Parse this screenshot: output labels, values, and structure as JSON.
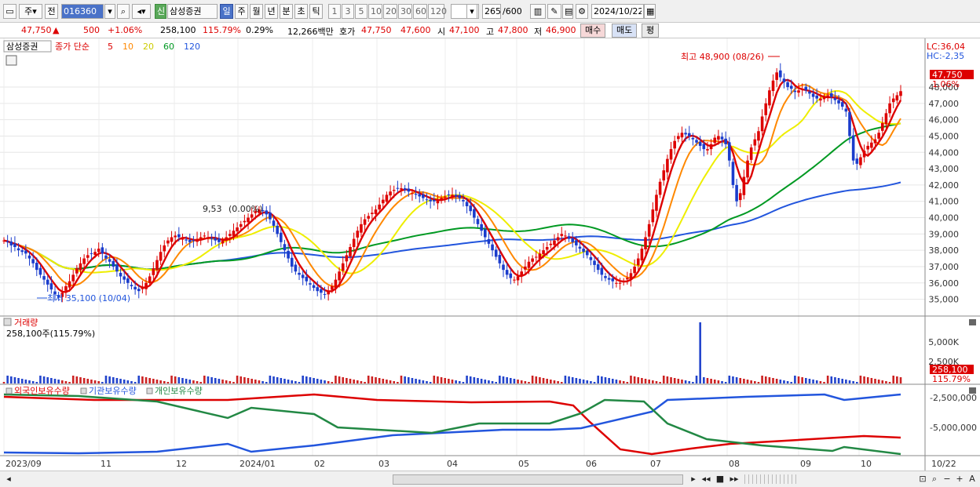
{
  "toolbar": {
    "type_select": "주",
    "prev_label": "전",
    "code": "016360",
    "tag_label": "신",
    "stock_name": "삼성증권",
    "periods": [
      "일",
      "주",
      "월",
      "년",
      "분",
      "초",
      "틱"
    ],
    "active_period": "일",
    "intervals": [
      "1",
      "3",
      "5",
      "10",
      "20",
      "30",
      "60",
      "120"
    ],
    "count": "265",
    "count_total": "/600",
    "date": "2024/10/22"
  },
  "quote": {
    "price": "47,750",
    "arrow": "▲",
    "change": "500",
    "change_pct": "+1.06%",
    "volume": "258,100",
    "volume_pct": "115.79%",
    "turnover_pct": "0.29%",
    "amount": "12,266백만",
    "ask_label": "호가",
    "ask1": "47,750",
    "ask2": "47,600",
    "open_label": "시",
    "open": "47,100",
    "high_label": "고",
    "high": "47,800",
    "low_label": "저",
    "low": "46,900",
    "buy_label": "매수",
    "sell_label": "매도",
    "eval_label": "평"
  },
  "price_pane": {
    "stock_label": "삼성증권",
    "legend_prefix": "종가 단순",
    "ma_periods": [
      "5",
      "10",
      "20",
      "60",
      "120"
    ],
    "ma_colors": [
      "#dd0000",
      "#ff8800",
      "#eeee00",
      "#009922",
      "#2255dd"
    ],
    "lc": "LC:36,04",
    "hc": "HC:-2,35",
    "price_tag": "47,750",
    "pct_tag": "1.06%",
    "high_annot": "최고 48,900 (08/26)",
    "low_annot": "최저 35,100 (10/04)",
    "mid_annot": "9,53",
    "mid_annot2": "(0.00%)",
    "yaxis": [
      "48,000",
      "47,000",
      "46,000",
      "45,000",
      "44,000",
      "43,000",
      "42,000",
      "41,000",
      "40,000",
      "39,000",
      "38,000",
      "37,000",
      "36,000",
      "35,000"
    ]
  },
  "volume_pane": {
    "title": "거래량",
    "info": "258,100주(115.79%)",
    "yaxis": [
      "5,000K",
      "2,500K"
    ],
    "tag": "258,100",
    "tag_pct": "115.79%"
  },
  "holding_pane": {
    "series": [
      "외국인보유수량",
      "기관보유수량",
      "개인보유수량"
    ],
    "colors": [
      "#dd0000",
      "#2255dd",
      "#228844"
    ],
    "yaxis": [
      "-2,500,000",
      "-5,000,000"
    ]
  },
  "xaxis": [
    "2023/09",
    "11",
    "12",
    "2024/01",
    "02",
    "03",
    "04",
    "05",
    "06",
    "07",
    "08",
    "09",
    "10"
  ],
  "xaxis_end": "10/22",
  "chart_data": [
    {
      "type": "candlestick",
      "title": "삼성증권",
      "ylim": [
        34500,
        49300
      ],
      "ma_lines": [
        "5",
        "10",
        "20",
        "60",
        "120"
      ],
      "closes": [
        38600,
        38500,
        38300,
        38200,
        38000,
        37900,
        37800,
        37500,
        37200,
        36800,
        36500,
        36200,
        35900,
        35600,
        35300,
        35100,
        35400,
        35800,
        36100,
        36500,
        36900,
        37200,
        37500,
        37700,
        37800,
        37900,
        38100,
        37800,
        37500,
        37300,
        37000,
        36700,
        36400,
        36200,
        36000,
        35800,
        35600,
        35500,
        35700,
        36000,
        36400,
        36900,
        37400,
        37900,
        38300,
        38600,
        38800,
        38900,
        38800,
        38700,
        38600,
        38500,
        38600,
        38700,
        38800,
        38900,
        38800,
        38700,
        38600,
        38500,
        38600,
        38800,
        39000,
        39200,
        39400,
        39600,
        39800,
        40000,
        40200,
        40400,
        40500,
        40400,
        40200,
        39900,
        39500,
        39000,
        38500,
        38000,
        37500,
        37000,
        36700,
        36500,
        36300,
        36100,
        35900,
        35700,
        35500,
        35400,
        35300,
        35500,
        35800,
        36200,
        36700,
        37200,
        37700,
        38200,
        38700,
        39200,
        39600,
        39900,
        40100,
        40300,
        40500,
        40800,
        41100,
        41400,
        41600,
        41700,
        41800,
        41800,
        41700,
        41600,
        41500,
        41400,
        41300,
        41200,
        41100,
        41000,
        41000,
        41100,
        41200,
        41300,
        41400,
        41400,
        41300,
        41200,
        41000,
        40700,
        40400,
        40000,
        39600,
        39200,
        38800,
        38400,
        38000,
        37600,
        37200,
        36800,
        36500,
        36300,
        36200,
        36400,
        36700,
        37000,
        37300,
        37500,
        37600,
        37800,
        38000,
        38200,
        38400,
        38600,
        38800,
        39000,
        38900,
        38700,
        38500,
        38300,
        38100,
        37900,
        37700,
        37400,
        37100,
        36800,
        36500,
        36300,
        36200,
        36100,
        36000,
        36000,
        36100,
        36300,
        36600,
        37000,
        37500,
        38100,
        38800,
        39600,
        40500,
        41400,
        42200,
        42900,
        43600,
        44200,
        44700,
        45000,
        45200,
        45100,
        45000,
        44800,
        44600,
        44400,
        44200,
        44200,
        44500,
        44900,
        45000,
        44800,
        44500,
        43500,
        42000,
        41000,
        41500,
        42500,
        43500,
        44300,
        44800,
        45300,
        46200,
        47000,
        47800,
        48400,
        48900,
        48600,
        48300,
        48000,
        47900,
        47700,
        47800,
        47900,
        47800,
        47600,
        47400,
        47300,
        47300,
        47400,
        47500,
        47400,
        47200,
        47000,
        46800,
        46500,
        45000,
        43500,
        43300,
        43700,
        44100,
        44400,
        44600,
        44800,
        45200,
        45800,
        46400,
        47000,
        47300,
        47500,
        47750
      ]
    },
    {
      "type": "bar",
      "title": "거래량",
      "ylim": [
        0,
        7000000
      ],
      "note": "daily volume, spike ~6,500K in June 2024"
    },
    {
      "type": "line",
      "title": "보유수량",
      "series_names": [
        "외국인보유수량",
        "기관보유수량",
        "개인보유수량"
      ]
    }
  ]
}
